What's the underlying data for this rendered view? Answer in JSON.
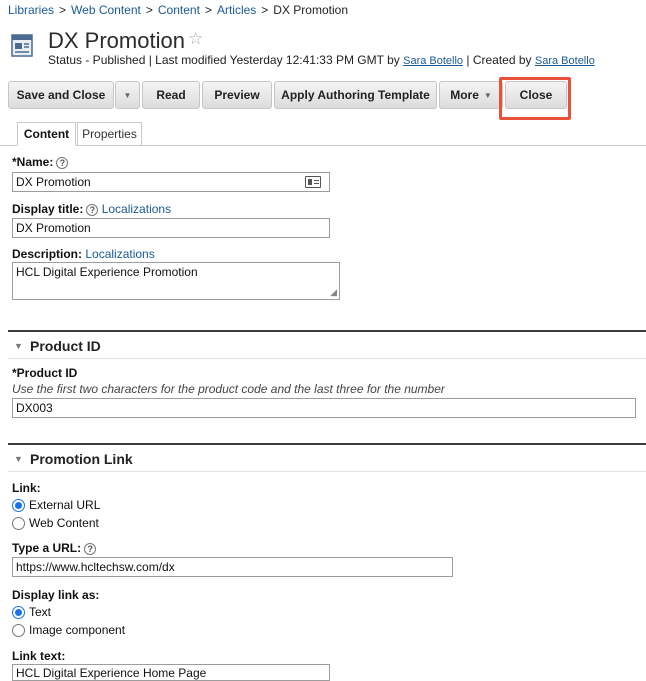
{
  "breadcrumb": {
    "items": [
      "Libraries",
      "Web Content",
      "Content",
      "Articles"
    ],
    "separator": ">",
    "current": "DX Promotion"
  },
  "header": {
    "title": "DX Promotion",
    "star_icon": "☆",
    "status_prefix": "Status - Published | Last modified Yesterday 12:41:33 PM GMT by",
    "modified_by": "Sara Botello",
    "created_prefix": "| Created by",
    "created_by": "Sara Botello"
  },
  "toolbar": {
    "save_close": "Save and Close",
    "read": "Read",
    "preview": "Preview",
    "apply_template": "Apply Authoring Template",
    "more": "More",
    "close": "Close"
  },
  "tabs": [
    "Content",
    "Properties"
  ],
  "form": {
    "name_label": "*Name:",
    "name_value": "DX Promotion",
    "display_title_label": "Display title:",
    "display_title_link": "Localizations",
    "display_title_value": "DX Promotion",
    "description_label": "Description:",
    "description_link": "Localizations",
    "description_value": "HCL Digital Experience Promotion"
  },
  "product_section": {
    "title": "Product ID",
    "field_label": "*Product ID",
    "hint": "Use the first two characters for the product code and the last three for the number",
    "value": "DX003"
  },
  "promotion_section": {
    "title": "Promotion Link",
    "link_label": "Link:",
    "link_options": [
      "External URL",
      "Web Content"
    ],
    "url_label": "Type a URL:",
    "url_value": "https://www.hcltechsw.com/dx",
    "display_as_label": "Display link as:",
    "display_options": [
      "Text",
      "Image component"
    ],
    "link_text_label": "Link text:",
    "link_text_value": "HCL Digital Experience Home Page"
  },
  "colors": {
    "link": "#1a5a96",
    "highlight": "#e8503a",
    "radio_selected": "#1a73e8"
  }
}
